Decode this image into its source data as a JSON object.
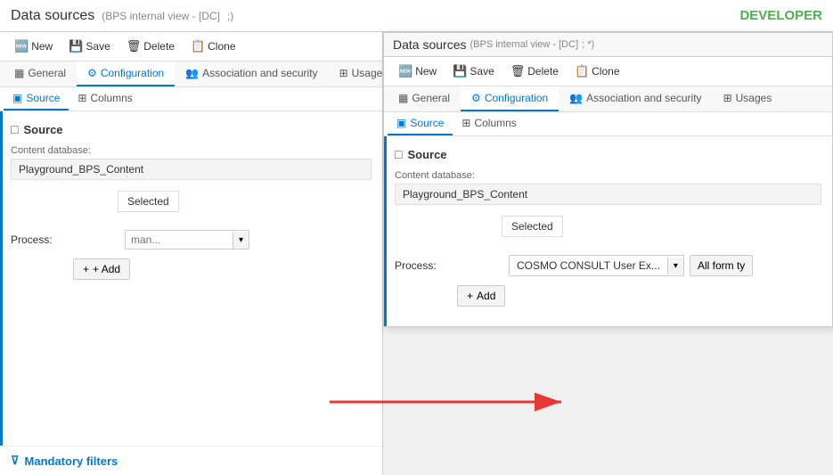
{
  "app": {
    "title": "Data sources",
    "subtitle": "(BPS internal view - [DC]",
    "subtitle_end": ";)",
    "developer_label": "DEVELOPER"
  },
  "left_panel": {
    "title": "Data sources",
    "subtitle": "(BPS internal view - [DC]",
    "subtitle_end": "; *)",
    "toolbar": {
      "new_label": "New",
      "save_label": "Save",
      "delete_label": "Delete",
      "clone_label": "Clone"
    },
    "tabs": [
      {
        "id": "general",
        "label": "General",
        "icon": "▦",
        "active": false
      },
      {
        "id": "configuration",
        "label": "Configuration",
        "icon": "⚙",
        "active": true
      },
      {
        "id": "association",
        "label": "Association and security",
        "icon": "👥",
        "active": false
      },
      {
        "id": "usages",
        "label": "Usages",
        "icon": "⊞",
        "active": false
      }
    ],
    "sub_tabs": [
      {
        "id": "source",
        "label": "Source",
        "icon": "▣",
        "active": true
      },
      {
        "id": "columns",
        "label": "Columns",
        "icon": "⊞",
        "active": false
      }
    ],
    "source_section": {
      "title": "Source",
      "content_database_label": "Content database:",
      "content_database_value": "Playground_BPS_Content",
      "selected_label": "Selected",
      "process_label": "Process:",
      "process_input_value": "",
      "process_placeholder": "man...",
      "add_button_label": "+ Add"
    },
    "mandatory_filters_label": "Mandatory filters"
  },
  "right_panel": {
    "title": "Data sources",
    "subtitle": "(BPS internal view - [DC]",
    "subtitle_end": "; *)",
    "toolbar": {
      "new_label": "New",
      "save_label": "Save",
      "delete_label": "Delete",
      "clone_label": "Clone"
    },
    "tabs": [
      {
        "id": "general",
        "label": "General",
        "icon": "▦",
        "active": false
      },
      {
        "id": "configuration",
        "label": "Configuration",
        "icon": "⚙",
        "active": true
      },
      {
        "id": "association",
        "label": "Association and security",
        "icon": "👥",
        "active": false
      },
      {
        "id": "usages",
        "label": "Usages",
        "icon": "⊞",
        "active": false
      }
    ],
    "sub_tabs": [
      {
        "id": "source",
        "label": "Source",
        "icon": "▣",
        "active": true
      },
      {
        "id": "columns",
        "label": "Columns",
        "icon": "⊞",
        "active": false
      }
    ],
    "source_section": {
      "title": "Source",
      "content_database_label": "Content database:",
      "content_database_value": "Playground_BPS_Content",
      "selected_label": "Selected",
      "process_label": "Process:",
      "process_dropdown_value": "COSMO CONSULT User Ex...",
      "all_form_label": "All form ty",
      "add_button_label": "+ Add"
    }
  },
  "icons": {
    "new": "🆕",
    "save": "💾",
    "delete": "🗑",
    "clone": "📋",
    "general": "▦",
    "configuration": "⚙",
    "association": "👥",
    "usages": "⊞",
    "source_tab": "▣",
    "columns_tab": "⊞",
    "source_section": "□",
    "filter": "⊽",
    "plus": "+"
  }
}
